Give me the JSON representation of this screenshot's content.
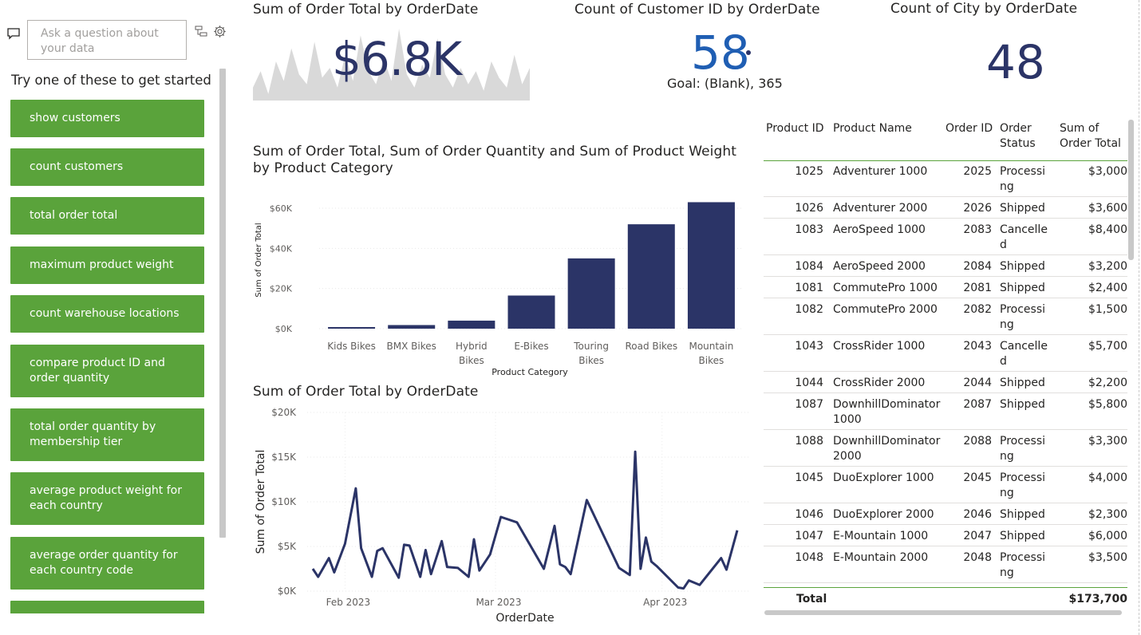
{
  "qna": {
    "placeholder": "Ask a question about your data",
    "try_text": "Try one of these to get started",
    "suggestions": [
      "show customers",
      "count customers",
      "total order total",
      "maximum product weight",
      "count warehouse locations",
      "compare product ID and order quantity",
      "total order quantity by membership tier",
      "average product weight for each country",
      "average order quantity for each country code",
      ""
    ]
  },
  "cards": {
    "sum_title": "Sum of Order Total by OrderDate",
    "sum_value": "$6.8K",
    "count_customer_title": "Count of Customer ID by OrderDate",
    "count_customer_value": "58",
    "goal_text": "Goal: (Blank), 365",
    "count_city_title": "Count of City by OrderDate",
    "count_city_value": "48"
  },
  "colors": {
    "bar": "#2b3467",
    "line": "#2b3467",
    "kpi_blue": "#1f5eb3",
    "suggestion_green": "#5aa33b",
    "sparkline_fill": "#d9d9d9"
  },
  "chart_data": [
    {
      "type": "bar",
      "title": "Sum of Order Total, Sum of Order Quantity and Sum of Product Weight by Product Category",
      "xlabel": "Product Category",
      "ylabel": "Sum of Order Total",
      "categories": [
        "Kids Bikes",
        "BMX Bikes",
        "Hybrid Bikes",
        "E-Bikes",
        "Touring Bikes",
        "Road Bikes",
        "Mountain Bikes"
      ],
      "values": [
        800,
        1800,
        4000,
        16500,
        35000,
        52000,
        63000
      ],
      "ylim": [
        0,
        60000
      ],
      "yticks": [
        "$0K",
        "$20K",
        "$40K",
        "$60K"
      ],
      "grid": true
    },
    {
      "type": "line",
      "title": "Sum of Order Total by OrderDate",
      "xlabel": "OrderDate",
      "ylabel": "Sum of Order Total",
      "xticks": [
        "Feb 2023",
        "Mar 2023",
        "Apr 2023"
      ],
      "yticks": [
        "$0K",
        "$5K",
        "$10K",
        "$15K",
        "$20K"
      ],
      "ylim": [
        0,
        20000
      ],
      "x": [
        "2023-01-26",
        "2023-01-27",
        "2023-01-29",
        "2023-01-30",
        "2023-02-01",
        "2023-02-03",
        "2023-02-04",
        "2023-02-06",
        "2023-02-07",
        "2023-02-08",
        "2023-02-11",
        "2023-02-12",
        "2023-02-13",
        "2023-02-15",
        "2023-02-16",
        "2023-02-17",
        "2023-02-19",
        "2023-02-20",
        "2023-02-22",
        "2023-02-24",
        "2023-02-25",
        "2023-02-26",
        "2023-02-28",
        "2023-03-02",
        "2023-03-05",
        "2023-03-10",
        "2023-03-12",
        "2023-03-13",
        "2023-03-14",
        "2023-03-15",
        "2023-03-18",
        "2023-03-24",
        "2023-03-26",
        "2023-03-27",
        "2023-03-28",
        "2023-03-29",
        "2023-03-30",
        "2023-03-31",
        "2023-04-04",
        "2023-04-05",
        "2023-04-06",
        "2023-04-08",
        "2023-04-12",
        "2023-04-13",
        "2023-04-15"
      ],
      "series": [
        {
          "values": [
            2500,
            1600,
            3700,
            2100,
            5300,
            11500,
            4800,
            1600,
            4500,
            4800,
            1500,
            5200,
            5100,
            1600,
            4600,
            1900,
            5600,
            2700,
            2600,
            1600,
            5800,
            2300,
            4100,
            8300,
            7700,
            2500,
            7300,
            3000,
            2700,
            1900,
            10200,
            2600,
            1800,
            15600,
            2500,
            6000,
            3300,
            2800,
            400,
            300,
            1200,
            700,
            3700,
            2400,
            6800
          ]
        }
      ]
    }
  ],
  "sparkline": [
    2000,
    4500,
    1000,
    6000,
    3000,
    8000,
    4000,
    2500,
    9000,
    3500,
    5000,
    2000,
    7000,
    3000,
    10000,
    4500,
    2500,
    6500,
    3000,
    11000,
    4000,
    2000,
    5500,
    3500,
    9500,
    4000,
    2000,
    5000,
    2500,
    4500,
    1500,
    6000,
    3500,
    2000,
    7000,
    2500,
    5000
  ],
  "table": {
    "headers": [
      "Product ID",
      "Product Name",
      "Order ID",
      "Order Status",
      "Sum of Order Total"
    ],
    "rows": [
      {
        "pid": "1025",
        "name": "Adventurer 1000",
        "oid": "2025",
        "status": "Processing",
        "total": "$3,000"
      },
      {
        "pid": "1026",
        "name": "Adventurer 2000",
        "oid": "2026",
        "status": "Shipped",
        "total": "$3,600"
      },
      {
        "pid": "1083",
        "name": "AeroSpeed 1000",
        "oid": "2083",
        "status": "Cancelled",
        "total": "$8,400"
      },
      {
        "pid": "1084",
        "name": "AeroSpeed 2000",
        "oid": "2084",
        "status": "Shipped",
        "total": "$3,200"
      },
      {
        "pid": "1081",
        "name": "CommutePro 1000",
        "oid": "2081",
        "status": "Shipped",
        "total": "$2,400"
      },
      {
        "pid": "1082",
        "name": "CommutePro 2000",
        "oid": "2082",
        "status": "Processing",
        "total": "$1,500"
      },
      {
        "pid": "1043",
        "name": "CrossRider 1000",
        "oid": "2043",
        "status": "Cancelled",
        "total": "$5,700"
      },
      {
        "pid": "1044",
        "name": "CrossRider 2000",
        "oid": "2044",
        "status": "Shipped",
        "total": "$2,200"
      },
      {
        "pid": "1087",
        "name": "DownhillDominator 1000",
        "oid": "2087",
        "status": "Shipped",
        "total": "$5,800"
      },
      {
        "pid": "1088",
        "name": "DownhillDominator 2000",
        "oid": "2088",
        "status": "Processing",
        "total": "$3,300"
      },
      {
        "pid": "1045",
        "name": "DuoExplorer 1000",
        "oid": "2045",
        "status": "Processing",
        "total": "$4,000"
      },
      {
        "pid": "1046",
        "name": "DuoExplorer 2000",
        "oid": "2046",
        "status": "Shipped",
        "total": "$2,300"
      },
      {
        "pid": "1047",
        "name": "E-Mountain 1000",
        "oid": "2047",
        "status": "Shipped",
        "total": "$6,000"
      },
      {
        "pid": "1048",
        "name": "E-Mountain 2000",
        "oid": "2048",
        "status": "Processing",
        "total": "$3,500"
      }
    ],
    "total_label": "Total",
    "total_value": "$173,700"
  }
}
